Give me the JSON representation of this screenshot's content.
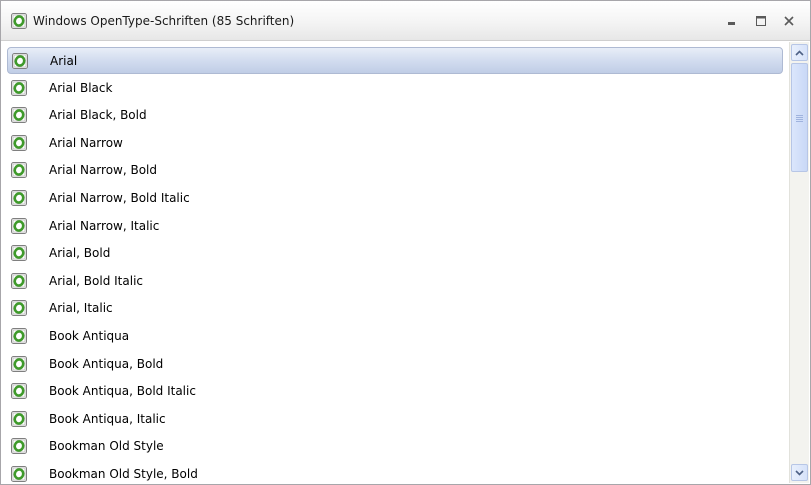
{
  "window": {
    "title": "Windows OpenType-Schriften (85 Schriften)",
    "icon": "opentype-font-icon",
    "controls": [
      "minimize-icon",
      "maximize-icon",
      "close-icon"
    ]
  },
  "fonts": {
    "selected_index": 0,
    "items": [
      "Arial",
      "Arial Black",
      "Arial Black, Bold",
      "Arial Narrow",
      "Arial Narrow, Bold",
      "Arial Narrow, Bold Italic",
      "Arial Narrow, Italic",
      "Arial, Bold",
      "Arial, Bold Italic",
      "Arial, Italic",
      "Book Antiqua",
      "Book Antiqua, Bold",
      "Book Antiqua, Bold Italic",
      "Book Antiqua, Italic",
      "Bookman Old Style",
      "Bookman Old Style, Bold"
    ]
  },
  "colors": {
    "selection": "#c8d4ec",
    "icon_green": "#3f9a2b",
    "icon_frame": "#7f7f7f"
  }
}
